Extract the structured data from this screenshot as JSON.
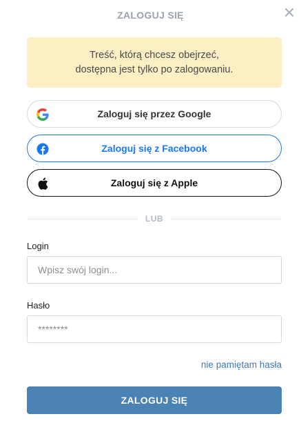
{
  "header": {
    "title": "ZALOGUJ SIĘ",
    "close_icon": "close-icon"
  },
  "notice": {
    "line1": "Treść, którą chcesz obejrzeć,",
    "line2": "dostępna jest tylko po zalogowaniu."
  },
  "social": {
    "google_label": "Zaloguj się przez Google",
    "google_icon": "google-logo-icon",
    "facebook_label": "Zaloguj się z Facebook",
    "facebook_icon": "facebook-logo-icon",
    "apple_label": "Zaloguj się z Apple",
    "apple_icon": "apple-logo-icon"
  },
  "divider": {
    "label": "LUB"
  },
  "form": {
    "login_label": "Login",
    "login_placeholder": "Wpisz swój login...",
    "login_value": "",
    "password_label": "Hasło",
    "password_placeholder": "********",
    "password_value": "",
    "forgot_label": "nie pamiętam hasła",
    "submit_label": "ZALOGUJ SIĘ"
  },
  "colors": {
    "notice_bg": "#fcefc4",
    "facebook_blue": "#1877f2",
    "primary_button": "#4a82b3",
    "link": "#3f7ab0",
    "title_gray": "#9aa3ad"
  }
}
